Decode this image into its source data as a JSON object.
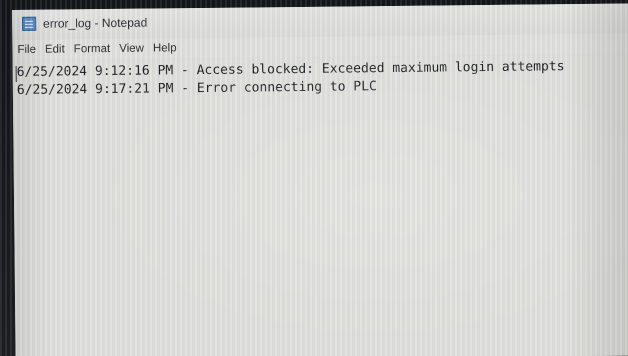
{
  "window": {
    "title": "error_log - Notepad",
    "icon": "notepad-icon"
  },
  "menubar": {
    "items": [
      "File",
      "Edit",
      "Format",
      "View",
      "Help"
    ]
  },
  "editor": {
    "lines": [
      "6/25/2024 9:12:16 PM - Access blocked: Exceeded maximum login attempts",
      "6/25/2024 9:17:21 PM - Error connecting to PLC"
    ]
  }
}
